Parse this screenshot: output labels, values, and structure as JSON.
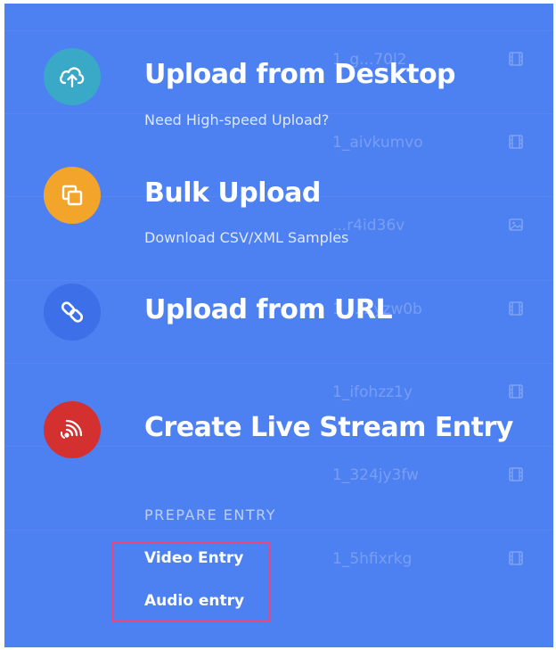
{
  "background_rows": [
    {
      "id": "1_g...70l2",
      "icon": "film-icon"
    },
    {
      "id": "1_aivkumvo",
      "icon": "film-icon"
    },
    {
      "id": "...r4id36v",
      "icon": "image-icon"
    },
    {
      "id": "1_...2yzw0b",
      "icon": "film-icon"
    },
    {
      "id": "1_ifohzz1y",
      "icon": "film-icon"
    },
    {
      "id": "1_324jy3fw",
      "icon": "film-icon"
    },
    {
      "id": "1_5hfixrkg",
      "icon": "film-icon"
    }
  ],
  "menu": {
    "upload_desktop": {
      "title": "Upload from Desktop",
      "subtitle": "Need High-speed Upload?",
      "icon": "cloud-upload-icon",
      "color": "#3aa9c7"
    },
    "bulk_upload": {
      "title": "Bulk Upload",
      "subtitle": "Download CSV/XML Samples",
      "icon": "copy-icon",
      "color": "#f2a52a"
    },
    "upload_url": {
      "title": "Upload from URL",
      "icon": "link-icon",
      "color": "#3d6fe8"
    },
    "live_stream": {
      "title": "Create Live Stream Entry",
      "icon": "broadcast-icon",
      "color": "#d43030"
    }
  },
  "prepare_entry": {
    "heading": "PREPARE ENTRY",
    "items": [
      "Video Entry",
      "Audio entry"
    ]
  },
  "colors": {
    "panel_bg": "#4d80f0",
    "highlight_border": "#e8467c"
  }
}
